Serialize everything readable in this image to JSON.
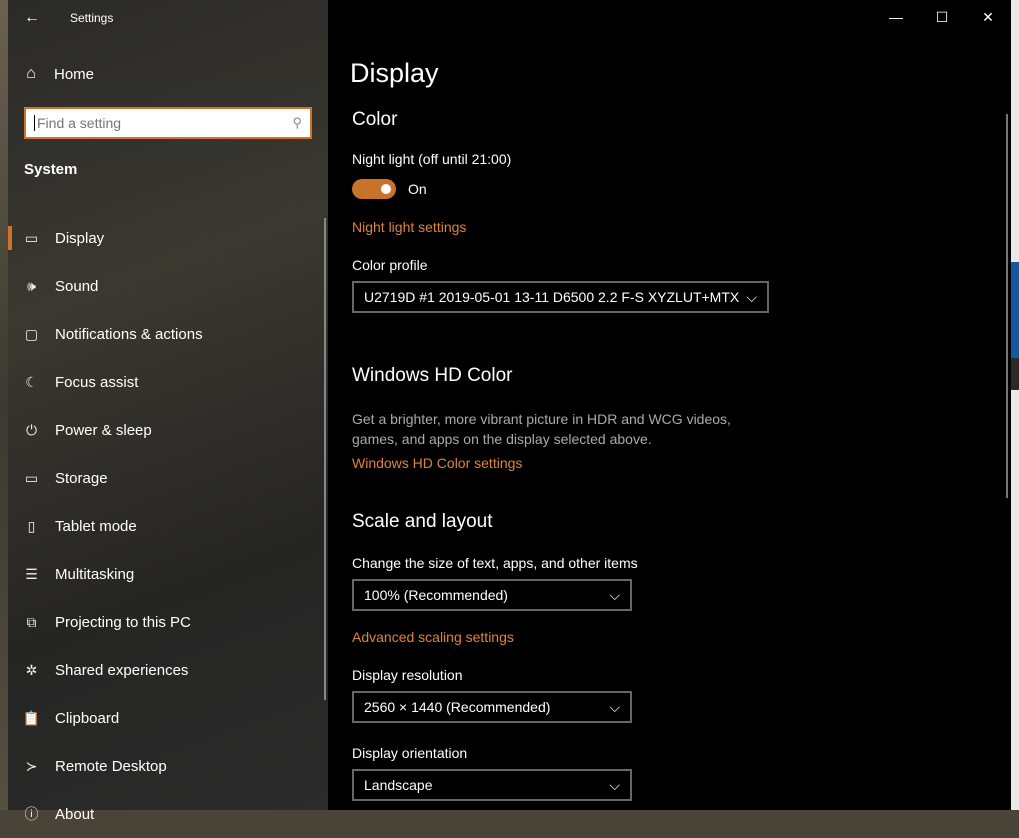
{
  "window": {
    "title": "Settings",
    "controls": [
      "—",
      "☐",
      "✕"
    ]
  },
  "sidebar": {
    "home": "Home",
    "search_placeholder": "Find a setting",
    "section": "System",
    "items": [
      {
        "label": "Display",
        "icon": "▭"
      },
      {
        "label": "Sound",
        "icon": "🕪"
      },
      {
        "label": "Notifications & actions",
        "icon": "▢"
      },
      {
        "label": "Focus assist",
        "icon": "☾"
      },
      {
        "label": "Power & sleep",
        "icon": "⏻"
      },
      {
        "label": "Storage",
        "icon": "▭"
      },
      {
        "label": "Tablet mode",
        "icon": "▯"
      },
      {
        "label": "Multitasking",
        "icon": "☰"
      },
      {
        "label": "Projecting to this PC",
        "icon": "⧉"
      },
      {
        "label": "Shared experiences",
        "icon": "✲"
      },
      {
        "label": "Clipboard",
        "icon": "📋"
      },
      {
        "label": "Remote Desktop",
        "icon": "≻"
      },
      {
        "label": "About",
        "icon": "ⓘ"
      }
    ]
  },
  "main": {
    "title": "Display",
    "color": {
      "heading": "Color",
      "night_light_label": "Night light (off until 21:00)",
      "toggle_state": "On",
      "night_light_link": "Night light settings",
      "profile_label": "Color profile",
      "profile_value": "U2719D #1 2019-05-01 13-11 D6500 2.2 F-S XYZLUT+MTX"
    },
    "hd": {
      "heading": "Windows HD Color",
      "desc": "Get a brighter, more vibrant picture in HDR and WCG videos, games, and apps on the display selected above.",
      "link": "Windows HD Color settings"
    },
    "scale": {
      "heading": "Scale and layout",
      "size_label": "Change the size of text, apps, and other items",
      "size_value": "100% (Recommended)",
      "adv_link": "Advanced scaling settings",
      "res_label": "Display resolution",
      "res_value": "2560 × 1440 (Recommended)",
      "orient_label": "Display orientation",
      "orient_value": "Landscape"
    }
  },
  "accent": "#d2722a"
}
